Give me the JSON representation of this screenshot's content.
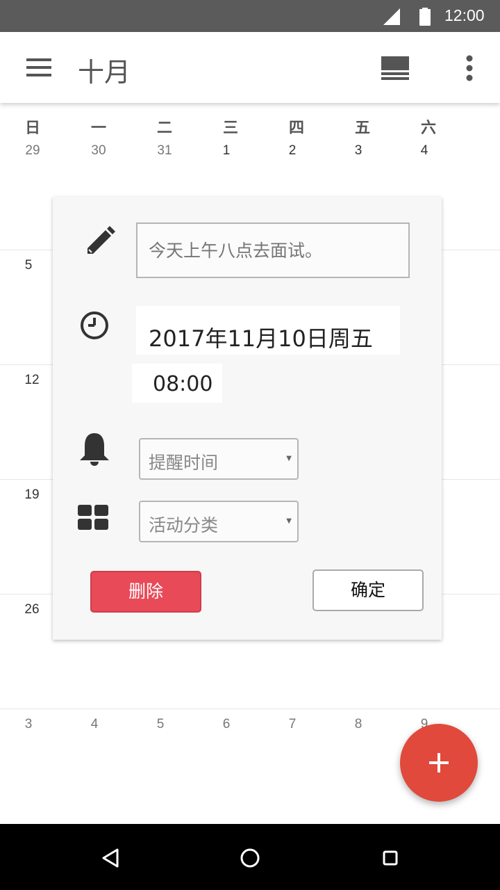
{
  "status_bar": {
    "time": "12:00",
    "signal_icon": "signal-icon",
    "battery_icon": "battery-icon"
  },
  "app_bar": {
    "title": "十月",
    "menu_icon": "hamburger-menu-icon",
    "view_icon": "calendar-view-icon",
    "more_icon": "more-vert-icon"
  },
  "calendar": {
    "weekdays": [
      "日",
      "一",
      "二",
      "三",
      "四",
      "五",
      "六"
    ],
    "weeks": [
      [
        "29",
        "30",
        "31",
        "1",
        "2",
        "3",
        "4"
      ],
      [
        "5"
      ],
      [
        "12"
      ],
      [
        "19"
      ],
      [
        "26"
      ],
      [
        "3",
        "4",
        "5",
        "6",
        "7",
        "8",
        "9"
      ]
    ]
  },
  "dialog": {
    "title_placeholder": "今天上午八点去面试。",
    "date": "2017年11月10日周五",
    "time": "08:00",
    "reminder_placeholder": "提醒时间",
    "category_placeholder": "活动分类",
    "delete_label": "删除",
    "confirm_label": "确定",
    "icons": [
      "pencil-icon",
      "clock-icon",
      "bell-icon",
      "grid-icon"
    ]
  },
  "fab": {
    "icon": "plus-icon",
    "color": "#e0493b"
  },
  "nav_bar": {
    "icons": [
      "back-icon",
      "home-icon",
      "recents-icon"
    ]
  },
  "colors": {
    "delete": "#e84a58",
    "status_bar": "#5b5b5b"
  }
}
